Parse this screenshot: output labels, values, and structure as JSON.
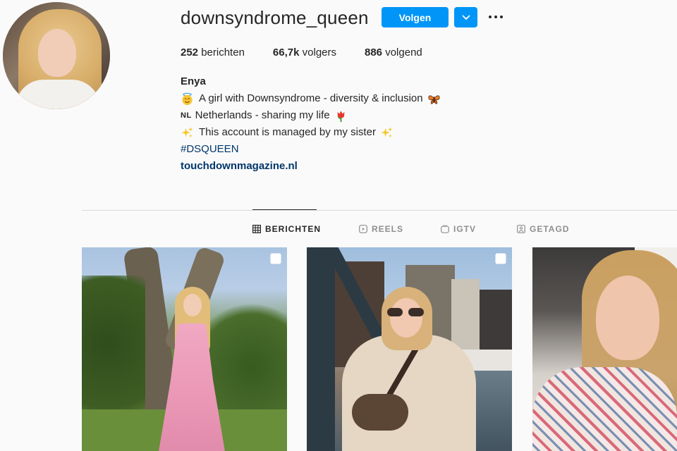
{
  "profile": {
    "username": "downsyndrome_queen",
    "follow_label": "Volgen",
    "stats": {
      "posts_count": "252",
      "posts_label": "berichten",
      "followers_count": "66,7k",
      "followers_label": "volgers",
      "following_count": "886",
      "following_label": "volgend"
    },
    "bio": {
      "name": "Enya",
      "line1": "A girl with Downsyndrome - diversity & inclusion",
      "line2_flag": "NL",
      "line2": "Netherlands - sharing my life",
      "line3": "This account is managed by my sister",
      "hashtag": "#DSQUEEN",
      "link": "touchdownmagazine.nl"
    }
  },
  "tabs": [
    {
      "label": "BERICHTEN",
      "icon": "grid-icon",
      "active": true
    },
    {
      "label": "REELS",
      "icon": "reels-icon",
      "active": false
    },
    {
      "label": "IGTV",
      "icon": "igtv-icon",
      "active": false
    },
    {
      "label": "GETAGD",
      "icon": "tagged-icon",
      "active": false
    }
  ],
  "colors": {
    "accent": "#0095f6",
    "link": "#00376b",
    "text": "#262626",
    "muted": "#8e8e8e",
    "background": "#fafafa",
    "divider": "#dbdbdb"
  }
}
